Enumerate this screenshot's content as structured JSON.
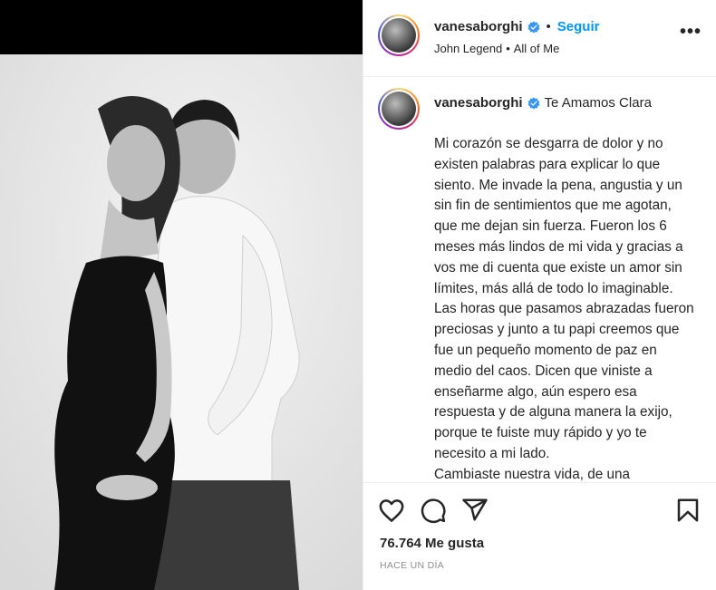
{
  "post": {
    "username": "vanesaborghi",
    "follow_label": "Seguir",
    "separator": "•",
    "audio": {
      "artist": "John Legend",
      "separator": "•",
      "song": "All of Me"
    },
    "more_label": "•••",
    "caption_title": "Te Amamos Clara",
    "caption_text": "Mi corazón se desgarra de dolor y no existen palabras para explicar lo que siento. Me invade la pena, angustia y un sin fin de sentimientos que me agotan, que me dejan sin fuerza. Fueron los 6 meses más lindos de mi vida y gracias a vos me di cuenta que existe un amor sin límites, más allá de todo lo imaginable. Las horas que pasamos abrazadas fueron preciosas y junto a tu papi creemos que fue un pequeño momento de paz en medio del caos. Dicen que viniste a enseñarme algo, aún espero esa respuesta y de alguna manera la exijo, porque te fuiste muy rápido y yo te necesito a mi lado.\nCambiaste nuestra vida, de una",
    "likes": "76.764 Me gusta",
    "timestamp": "HACE UN DÍA"
  },
  "icons": {
    "verified": "verified-badge-icon",
    "like": "heart-icon",
    "comment": "comment-icon",
    "share": "paper-plane-icon",
    "save": "bookmark-icon"
  },
  "colors": {
    "follow": "#0095f6",
    "verified": "#3897f0",
    "text": "#262626",
    "muted": "#8e8e8e"
  }
}
